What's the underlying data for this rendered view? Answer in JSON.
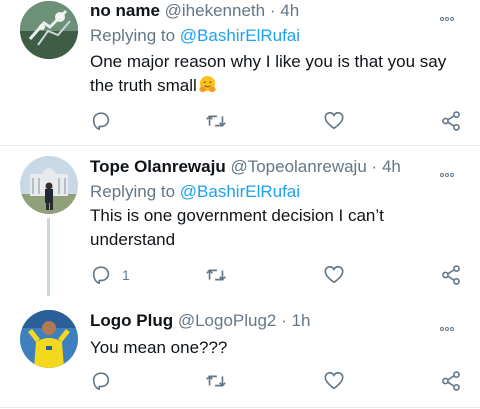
{
  "tweets": [
    {
      "name": "no name",
      "handle": "@ihekenneth",
      "sep": "·",
      "time": "4h",
      "replying_prefix": "Replying to",
      "replying_to": "@BashirElRufai",
      "line1": "One major reason why I like you is that you say",
      "line2": "the truth small",
      "emoji": "hugging-face-icon",
      "reply_count": "",
      "colors": {
        "avatar_bg": "#6f8f73"
      }
    },
    {
      "name": "Tope Olanrewaju",
      "handle": "@Topeolanrewaju",
      "sep": "·",
      "time": "4h",
      "replying_prefix": "Replying to",
      "replying_to": "@BashirElRufai",
      "line1": "This is one government decision I can’t",
      "line2": "understand",
      "reply_count": "1",
      "colors": {
        "avatar_bg": "#a8b8c8"
      }
    },
    {
      "name": "Logo Plug",
      "handle": "@LogoPlug2",
      "sep": "·",
      "time": "1h",
      "line1": "You mean one???",
      "reply_count": "",
      "colors": {
        "avatar_bg": "#2f7ec8"
      }
    }
  ],
  "colors": {
    "text": "#0f1419",
    "secondary": "#657786",
    "link": "#1da1f2",
    "divider": "#e6ecf0"
  }
}
